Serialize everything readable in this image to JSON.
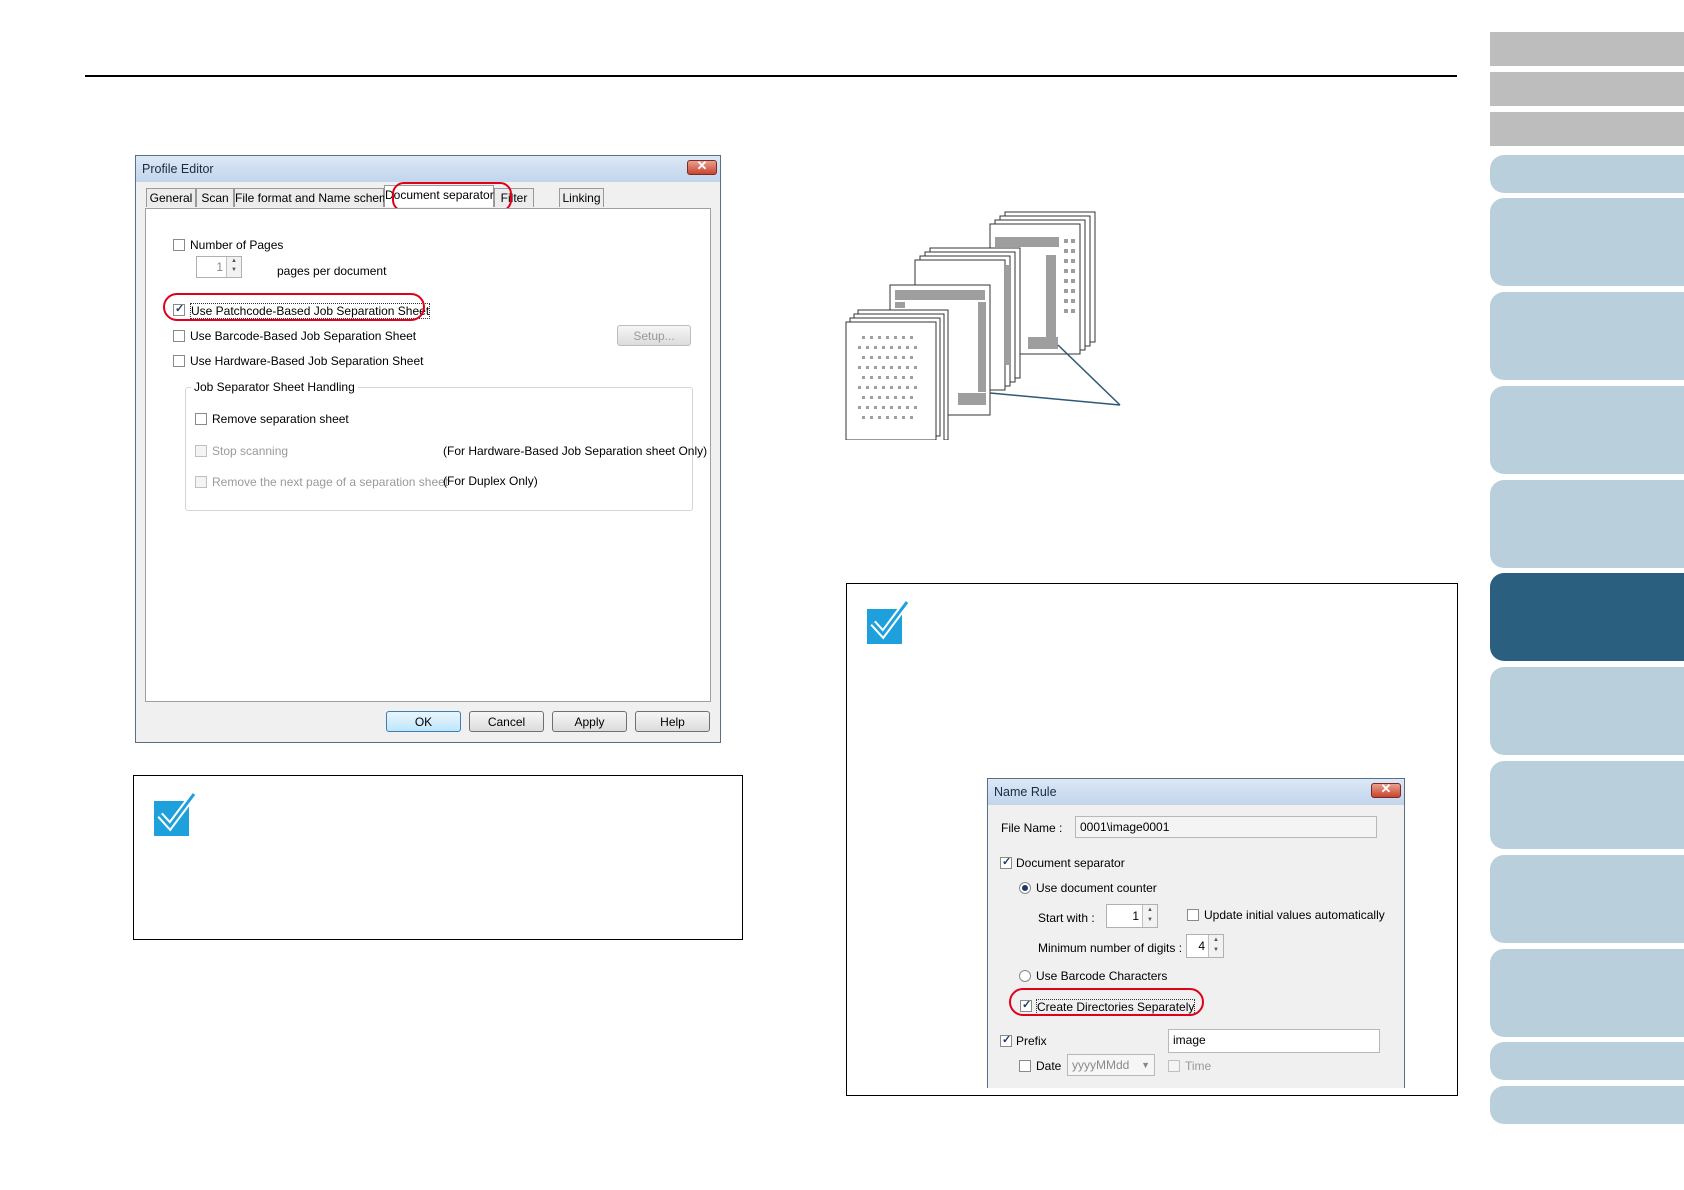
{
  "profile_editor": {
    "title": "Profile Editor",
    "close_glyph": "✕",
    "tabs": [
      "General",
      "Scan",
      "File format and Name scheme",
      "Document separator",
      "Filter",
      "Linking"
    ],
    "selected_tab": "Document separator",
    "number_of_pages_label": "Number of Pages",
    "pages_value": "1",
    "pages_per_document_label": "pages per document",
    "patchcode_label": "Use Patchcode-Based Job Separation Sheet",
    "barcode_label": "Use Barcode-Based Job Separation Sheet",
    "hardware_label": "Use Hardware-Based Job Separation Sheet",
    "setup_label": "Setup...",
    "group_label": "Job Separator Sheet Handling",
    "remove_sheet_label": "Remove separation sheet",
    "stop_scanning_label": "Stop scanning",
    "stop_scanning_note": "(For Hardware-Based Job Separation sheet Only)",
    "remove_next_label": "Remove the next page of a separation sheet",
    "remove_next_note": "(For Duplex Only)",
    "buttons": {
      "ok": "OK",
      "cancel": "Cancel",
      "apply": "Apply",
      "help": "Help"
    }
  },
  "name_rule": {
    "title": "Name Rule",
    "close_glyph": "✕",
    "file_name_label": "File Name :",
    "file_name_value": "0001\\image0001",
    "document_separator_label": "Document separator",
    "use_counter_label": "Use document counter",
    "start_with_label": "Start with :",
    "start_with_value": "1",
    "update_initial_label": "Update initial values automatically",
    "min_digits_label": "Minimum number of digits :",
    "min_digits_value": "4",
    "use_barcode_label": "Use Barcode Characters",
    "create_dirs_label": "Create Directories Separately",
    "prefix_label": "Prefix",
    "prefix_value": "image",
    "date_label": "Date",
    "date_format": "yyyyMMdd",
    "time_label": "Time"
  },
  "colors": {
    "highlight": "#e0001a",
    "sidebar_tab": "#b9cfdc",
    "sidebar_active": "#2b5f7f",
    "sidebar_gray": "#bdbdbd",
    "note_check": "#1ea0dc"
  },
  "icons": [
    "check-note-icon",
    "close-icon",
    "dropdown-arrow-icon",
    "spin-arrows-icon"
  ]
}
